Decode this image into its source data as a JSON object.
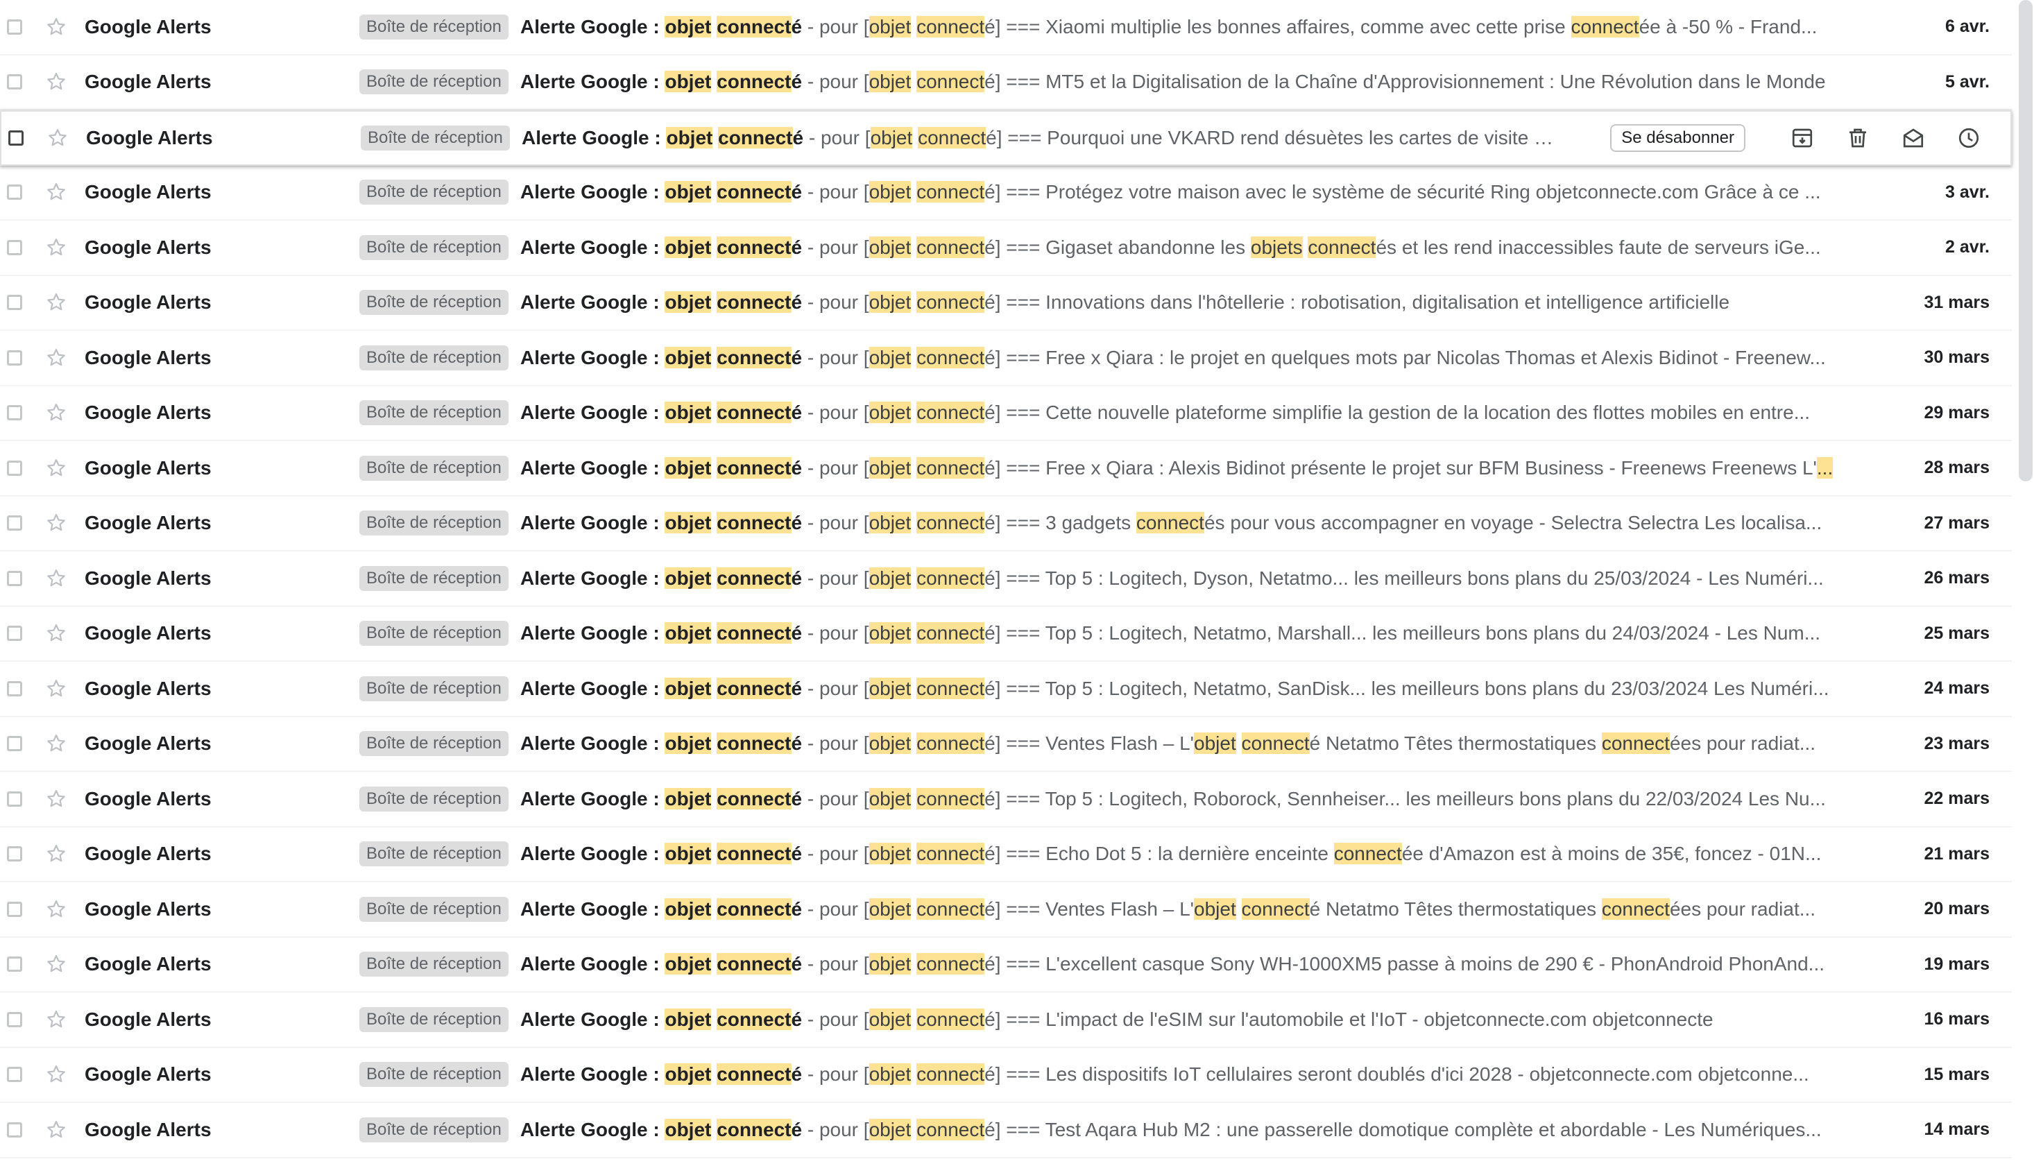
{
  "icons": {
    "checkbox": "checkbox-icon",
    "star": "star-icon",
    "archive": "archive-icon",
    "delete": "trash-icon",
    "mark_unread": "envelope-icon",
    "snooze": "clock-icon"
  },
  "colors": {
    "highlight": "#fde293",
    "label_chip_bg": "#dddddd",
    "row_divider": "#f1f3f4"
  },
  "hover_actions": {
    "unsubscribe_label": "Se désabonner"
  },
  "emails": [
    {
      "sender": "Google Alerts",
      "label": "Boîte de réception",
      "subject": [
        {
          "t": "Alerte Google : "
        },
        {
          "t": "objet",
          "hl": true
        },
        {
          "t": " "
        },
        {
          "t": "connect",
          "hl": true
        },
        {
          "t": "é"
        }
      ],
      "snippet": [
        {
          "t": " - pour ["
        },
        {
          "t": "objet",
          "hl": true
        },
        {
          "t": " "
        },
        {
          "t": "connect",
          "hl": true
        },
        {
          "t": "é] === Xiaomi multiplie les bonnes affaires, comme avec cette prise "
        },
        {
          "t": "connect",
          "hl": true
        },
        {
          "t": "ée à -50 % - Frand..."
        }
      ],
      "date": "6 avr."
    },
    {
      "sender": "Google Alerts",
      "label": "Boîte de réception",
      "subject": [
        {
          "t": "Alerte Google : "
        },
        {
          "t": "objet",
          "hl": true
        },
        {
          "t": " "
        },
        {
          "t": "connect",
          "hl": true
        },
        {
          "t": "é"
        }
      ],
      "snippet": [
        {
          "t": " - pour ["
        },
        {
          "t": "objet",
          "hl": true
        },
        {
          "t": " "
        },
        {
          "t": "connect",
          "hl": true
        },
        {
          "t": "é] === MT5 et la Digitalisation de la Chaîne d'Approvisionnement : Une Révolution dans le Monde"
        }
      ],
      "date": "5 avr."
    },
    {
      "sender": "Google Alerts",
      "label": "Boîte de réception",
      "hovered": true,
      "subject": [
        {
          "t": "Alerte Google : "
        },
        {
          "t": "objet",
          "hl": true
        },
        {
          "t": " "
        },
        {
          "t": "connect",
          "hl": true
        },
        {
          "t": "é"
        }
      ],
      "snippet": [
        {
          "t": " - pour ["
        },
        {
          "t": "objet",
          "hl": true
        },
        {
          "t": " "
        },
        {
          "t": "connect",
          "hl": true
        },
        {
          "t": "é] === Pourquoi une VKARD rend désuètes les cartes de visite en ..."
        }
      ],
      "date": ""
    },
    {
      "sender": "Google Alerts",
      "label": "Boîte de réception",
      "subject": [
        {
          "t": "Alerte Google : "
        },
        {
          "t": "objet",
          "hl": true
        },
        {
          "t": " "
        },
        {
          "t": "connect",
          "hl": true
        },
        {
          "t": "é"
        }
      ],
      "snippet": [
        {
          "t": " - pour ["
        },
        {
          "t": "objet",
          "hl": true
        },
        {
          "t": " "
        },
        {
          "t": "connect",
          "hl": true
        },
        {
          "t": "é] === Protégez votre maison avec le système de sécurité Ring objetconnecte.com Grâce à ce ..."
        }
      ],
      "date": "3 avr."
    },
    {
      "sender": "Google Alerts",
      "label": "Boîte de réception",
      "subject": [
        {
          "t": "Alerte Google : "
        },
        {
          "t": "objet",
          "hl": true
        },
        {
          "t": " "
        },
        {
          "t": "connect",
          "hl": true
        },
        {
          "t": "é"
        }
      ],
      "snippet": [
        {
          "t": " - pour ["
        },
        {
          "t": "objet",
          "hl": true
        },
        {
          "t": " "
        },
        {
          "t": "connect",
          "hl": true
        },
        {
          "t": "é] === Gigaset abandonne les "
        },
        {
          "t": "objets",
          "hl": true
        },
        {
          "t": " "
        },
        {
          "t": "connect",
          "hl": true
        },
        {
          "t": "és et les rend inaccessibles faute de serveurs iGe..."
        }
      ],
      "date": "2 avr."
    },
    {
      "sender": "Google Alerts",
      "label": "Boîte de réception",
      "subject": [
        {
          "t": "Alerte Google : "
        },
        {
          "t": "objet",
          "hl": true
        },
        {
          "t": " "
        },
        {
          "t": "connect",
          "hl": true
        },
        {
          "t": "é"
        }
      ],
      "snippet": [
        {
          "t": " - pour ["
        },
        {
          "t": "objet",
          "hl": true
        },
        {
          "t": " "
        },
        {
          "t": "connect",
          "hl": true
        },
        {
          "t": "é] === Innovations dans l'hôtellerie : robotisation, digitalisation et intelligence artificielle"
        }
      ],
      "date": "31 mars"
    },
    {
      "sender": "Google Alerts",
      "label": "Boîte de réception",
      "subject": [
        {
          "t": "Alerte Google : "
        },
        {
          "t": "objet",
          "hl": true
        },
        {
          "t": " "
        },
        {
          "t": "connect",
          "hl": true
        },
        {
          "t": "é"
        }
      ],
      "snippet": [
        {
          "t": " - pour ["
        },
        {
          "t": "objet",
          "hl": true
        },
        {
          "t": " "
        },
        {
          "t": "connect",
          "hl": true
        },
        {
          "t": "é] === Free x Qiara : le projet en quelques mots par Nicolas Thomas et Alexis Bidinot - Freenew..."
        }
      ],
      "date": "30 mars"
    },
    {
      "sender": "Google Alerts",
      "label": "Boîte de réception",
      "subject": [
        {
          "t": "Alerte Google : "
        },
        {
          "t": "objet",
          "hl": true
        },
        {
          "t": " "
        },
        {
          "t": "connect",
          "hl": true
        },
        {
          "t": "é"
        }
      ],
      "snippet": [
        {
          "t": " - pour ["
        },
        {
          "t": "objet",
          "hl": true
        },
        {
          "t": " "
        },
        {
          "t": "connect",
          "hl": true
        },
        {
          "t": "é] === Cette nouvelle plateforme simplifie la gestion de la location des flottes mobiles en entre..."
        }
      ],
      "date": "29 mars"
    },
    {
      "sender": "Google Alerts",
      "label": "Boîte de réception",
      "subject": [
        {
          "t": "Alerte Google : "
        },
        {
          "t": "objet",
          "hl": true
        },
        {
          "t": " "
        },
        {
          "t": "connect",
          "hl": true
        },
        {
          "t": "é"
        }
      ],
      "snippet": [
        {
          "t": " - pour ["
        },
        {
          "t": "objet",
          "hl": true
        },
        {
          "t": " "
        },
        {
          "t": "connect",
          "hl": true
        },
        {
          "t": "é] === Free x Qiara : Alexis Bidinot présente le projet sur BFM Business - Freenews Freenews L'"
        },
        {
          "t": "...",
          "hl": true
        }
      ],
      "date": "28 mars"
    },
    {
      "sender": "Google Alerts",
      "label": "Boîte de réception",
      "subject": [
        {
          "t": "Alerte Google : "
        },
        {
          "t": "objet",
          "hl": true
        },
        {
          "t": " "
        },
        {
          "t": "connect",
          "hl": true
        },
        {
          "t": "é"
        }
      ],
      "snippet": [
        {
          "t": " - pour ["
        },
        {
          "t": "objet",
          "hl": true
        },
        {
          "t": " "
        },
        {
          "t": "connect",
          "hl": true
        },
        {
          "t": "é] === 3 gadgets "
        },
        {
          "t": "connect",
          "hl": true
        },
        {
          "t": "és pour vous accompagner en voyage - Selectra Selectra Les localisa..."
        }
      ],
      "date": "27 mars"
    },
    {
      "sender": "Google Alerts",
      "label": "Boîte de réception",
      "subject": [
        {
          "t": "Alerte Google : "
        },
        {
          "t": "objet",
          "hl": true
        },
        {
          "t": " "
        },
        {
          "t": "connect",
          "hl": true
        },
        {
          "t": "é"
        }
      ],
      "snippet": [
        {
          "t": " - pour ["
        },
        {
          "t": "objet",
          "hl": true
        },
        {
          "t": " "
        },
        {
          "t": "connect",
          "hl": true
        },
        {
          "t": "é] === Top 5 : Logitech, Dyson, Netatmo... les meilleurs bons plans du 25/03/2024 - Les Numéri..."
        }
      ],
      "date": "26 mars"
    },
    {
      "sender": "Google Alerts",
      "label": "Boîte de réception",
      "subject": [
        {
          "t": "Alerte Google : "
        },
        {
          "t": "objet",
          "hl": true
        },
        {
          "t": " "
        },
        {
          "t": "connect",
          "hl": true
        },
        {
          "t": "é"
        }
      ],
      "snippet": [
        {
          "t": " - pour ["
        },
        {
          "t": "objet",
          "hl": true
        },
        {
          "t": " "
        },
        {
          "t": "connect",
          "hl": true
        },
        {
          "t": "é] === Top 5 : Logitech, Netatmo, Marshall... les meilleurs bons plans du 24/03/2024 - Les Num..."
        }
      ],
      "date": "25 mars"
    },
    {
      "sender": "Google Alerts",
      "label": "Boîte de réception",
      "subject": [
        {
          "t": "Alerte Google : "
        },
        {
          "t": "objet",
          "hl": true
        },
        {
          "t": " "
        },
        {
          "t": "connect",
          "hl": true
        },
        {
          "t": "é"
        }
      ],
      "snippet": [
        {
          "t": " - pour ["
        },
        {
          "t": "objet",
          "hl": true
        },
        {
          "t": " "
        },
        {
          "t": "connect",
          "hl": true
        },
        {
          "t": "é] === Top 5 : Logitech, Netatmo, SanDisk... les meilleurs bons plans du 23/03/2024 Les Numéri..."
        }
      ],
      "date": "24 mars"
    },
    {
      "sender": "Google Alerts",
      "label": "Boîte de réception",
      "subject": [
        {
          "t": "Alerte Google : "
        },
        {
          "t": "objet",
          "hl": true
        },
        {
          "t": " "
        },
        {
          "t": "connect",
          "hl": true
        },
        {
          "t": "é"
        }
      ],
      "snippet": [
        {
          "t": " - pour ["
        },
        {
          "t": "objet",
          "hl": true
        },
        {
          "t": " "
        },
        {
          "t": "connect",
          "hl": true
        },
        {
          "t": "é] === Ventes Flash – L'"
        },
        {
          "t": "objet",
          "hl": true
        },
        {
          "t": " "
        },
        {
          "t": "connect",
          "hl": true
        },
        {
          "t": "é Netatmo Têtes thermostatiques "
        },
        {
          "t": "connect",
          "hl": true
        },
        {
          "t": "ées pour radiat..."
        }
      ],
      "date": "23 mars"
    },
    {
      "sender": "Google Alerts",
      "label": "Boîte de réception",
      "subject": [
        {
          "t": "Alerte Google : "
        },
        {
          "t": "objet",
          "hl": true
        },
        {
          "t": " "
        },
        {
          "t": "connect",
          "hl": true
        },
        {
          "t": "é"
        }
      ],
      "snippet": [
        {
          "t": " - pour ["
        },
        {
          "t": "objet",
          "hl": true
        },
        {
          "t": " "
        },
        {
          "t": "connect",
          "hl": true
        },
        {
          "t": "é] === Top 5 : Logitech, Roborock, Sennheiser... les meilleurs bons plans du 22/03/2024 Les Nu..."
        }
      ],
      "date": "22 mars"
    },
    {
      "sender": "Google Alerts",
      "label": "Boîte de réception",
      "subject": [
        {
          "t": "Alerte Google : "
        },
        {
          "t": "objet",
          "hl": true
        },
        {
          "t": " "
        },
        {
          "t": "connect",
          "hl": true
        },
        {
          "t": "é"
        }
      ],
      "snippet": [
        {
          "t": " - pour ["
        },
        {
          "t": "objet",
          "hl": true
        },
        {
          "t": " "
        },
        {
          "t": "connect",
          "hl": true
        },
        {
          "t": "é] === Echo Dot 5 : la dernière enceinte "
        },
        {
          "t": "connect",
          "hl": true
        },
        {
          "t": "ée d'Amazon est à moins de 35€, foncez - 01N..."
        }
      ],
      "date": "21 mars"
    },
    {
      "sender": "Google Alerts",
      "label": "Boîte de réception",
      "subject": [
        {
          "t": "Alerte Google : "
        },
        {
          "t": "objet",
          "hl": true
        },
        {
          "t": " "
        },
        {
          "t": "connect",
          "hl": true
        },
        {
          "t": "é"
        }
      ],
      "snippet": [
        {
          "t": " - pour ["
        },
        {
          "t": "objet",
          "hl": true
        },
        {
          "t": " "
        },
        {
          "t": "connect",
          "hl": true
        },
        {
          "t": "é] === Ventes Flash – L'"
        },
        {
          "t": "objet",
          "hl": true
        },
        {
          "t": " "
        },
        {
          "t": "connect",
          "hl": true
        },
        {
          "t": "é Netatmo Têtes thermostatiques "
        },
        {
          "t": "connect",
          "hl": true
        },
        {
          "t": "ées pour radiat..."
        }
      ],
      "date": "20 mars"
    },
    {
      "sender": "Google Alerts",
      "label": "Boîte de réception",
      "subject": [
        {
          "t": "Alerte Google : "
        },
        {
          "t": "objet",
          "hl": true
        },
        {
          "t": " "
        },
        {
          "t": "connect",
          "hl": true
        },
        {
          "t": "é"
        }
      ],
      "snippet": [
        {
          "t": " - pour ["
        },
        {
          "t": "objet",
          "hl": true
        },
        {
          "t": " "
        },
        {
          "t": "connect",
          "hl": true
        },
        {
          "t": "é] === L'excellent casque Sony WH-1000XM5 passe à moins de 290 € - PhonAndroid PhonAnd..."
        }
      ],
      "date": "19 mars"
    },
    {
      "sender": "Google Alerts",
      "label": "Boîte de réception",
      "subject": [
        {
          "t": "Alerte Google : "
        },
        {
          "t": "objet",
          "hl": true
        },
        {
          "t": " "
        },
        {
          "t": "connect",
          "hl": true
        },
        {
          "t": "é"
        }
      ],
      "snippet": [
        {
          "t": " - pour ["
        },
        {
          "t": "objet",
          "hl": true
        },
        {
          "t": " "
        },
        {
          "t": "connect",
          "hl": true
        },
        {
          "t": "é] === L'impact de l'eSIM sur l'automobile et l'IoT - objetconnecte.com objetconnecte"
        }
      ],
      "date": "16 mars"
    },
    {
      "sender": "Google Alerts",
      "label": "Boîte de réception",
      "subject": [
        {
          "t": "Alerte Google : "
        },
        {
          "t": "objet",
          "hl": true
        },
        {
          "t": " "
        },
        {
          "t": "connect",
          "hl": true
        },
        {
          "t": "é"
        }
      ],
      "snippet": [
        {
          "t": " - pour ["
        },
        {
          "t": "objet",
          "hl": true
        },
        {
          "t": " "
        },
        {
          "t": "connect",
          "hl": true
        },
        {
          "t": "é] === Les dispositifs IoT cellulaires seront doublés d'ici 2028 - objetconnecte.com objetconne..."
        }
      ],
      "date": "15 mars"
    },
    {
      "sender": "Google Alerts",
      "label": "Boîte de réception",
      "subject": [
        {
          "t": "Alerte Google : "
        },
        {
          "t": "objet",
          "hl": true
        },
        {
          "t": " "
        },
        {
          "t": "connect",
          "hl": true
        },
        {
          "t": "é"
        }
      ],
      "snippet": [
        {
          "t": " - pour ["
        },
        {
          "t": "objet",
          "hl": true
        },
        {
          "t": " "
        },
        {
          "t": "connect",
          "hl": true
        },
        {
          "t": "é] === Test Aqara Hub M2 : une passerelle domotique complète et abordable - Les Numériques..."
        }
      ],
      "date": "14 mars"
    }
  ]
}
